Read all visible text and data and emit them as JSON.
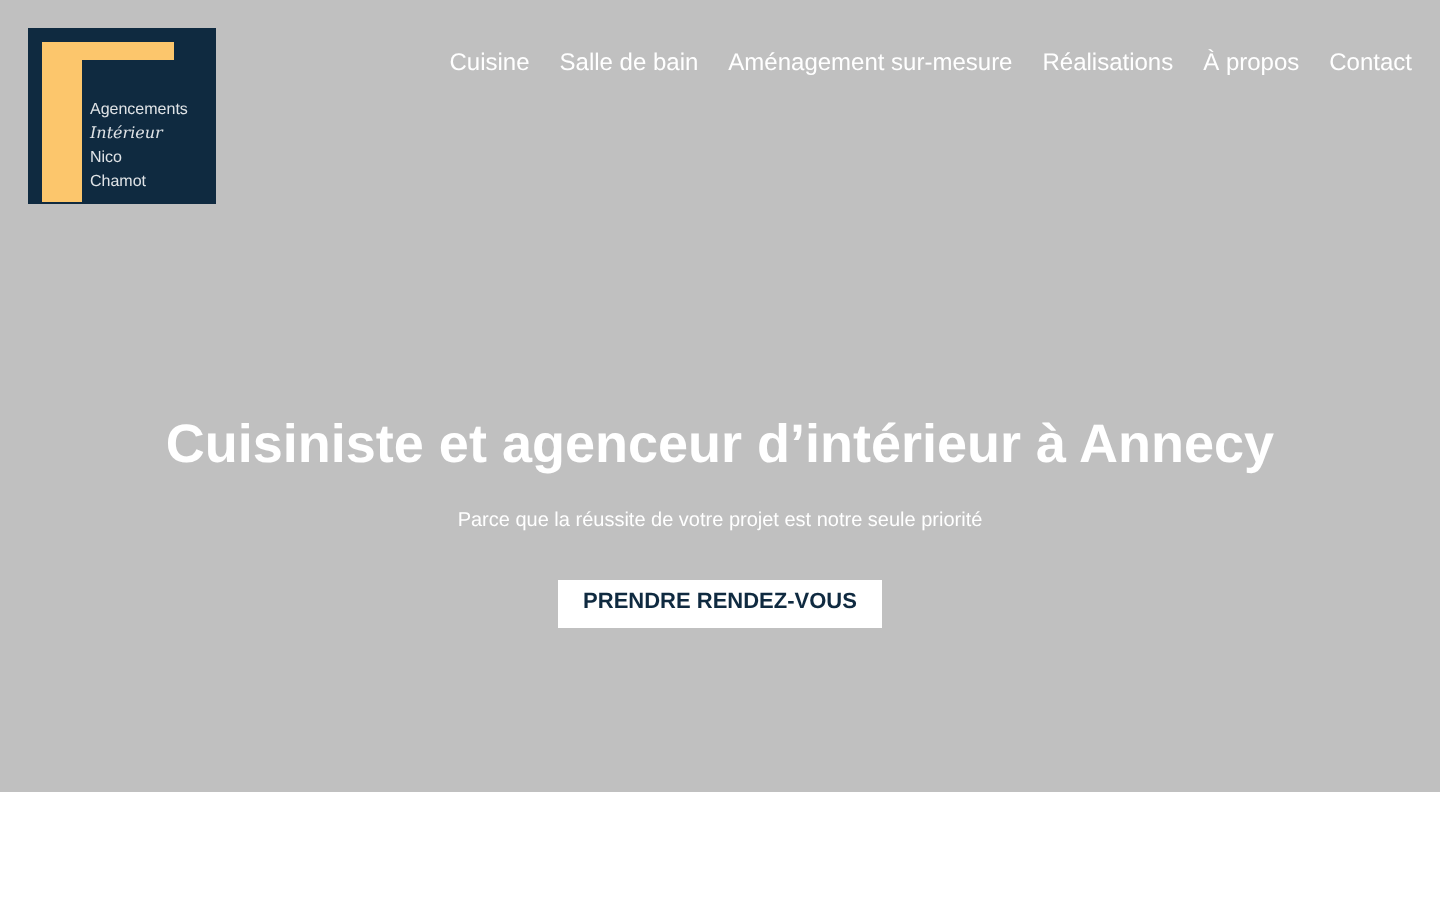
{
  "logo": {
    "lines": [
      "Agencements",
      "Intérieur",
      "Nico",
      "Chamot"
    ]
  },
  "nav": {
    "items": [
      "Cuisine",
      "Salle de bain",
      "Aménagement sur-mesure",
      "Réalisations",
      "À propos",
      "Contact"
    ]
  },
  "hero": {
    "title": "Cuisiniste et agenceur d’intérieur à Annecy",
    "subtitle": "Parce que la réussite de votre projet est notre seule priorité",
    "button": "PRENDRE RENDEZ-VOUS"
  }
}
